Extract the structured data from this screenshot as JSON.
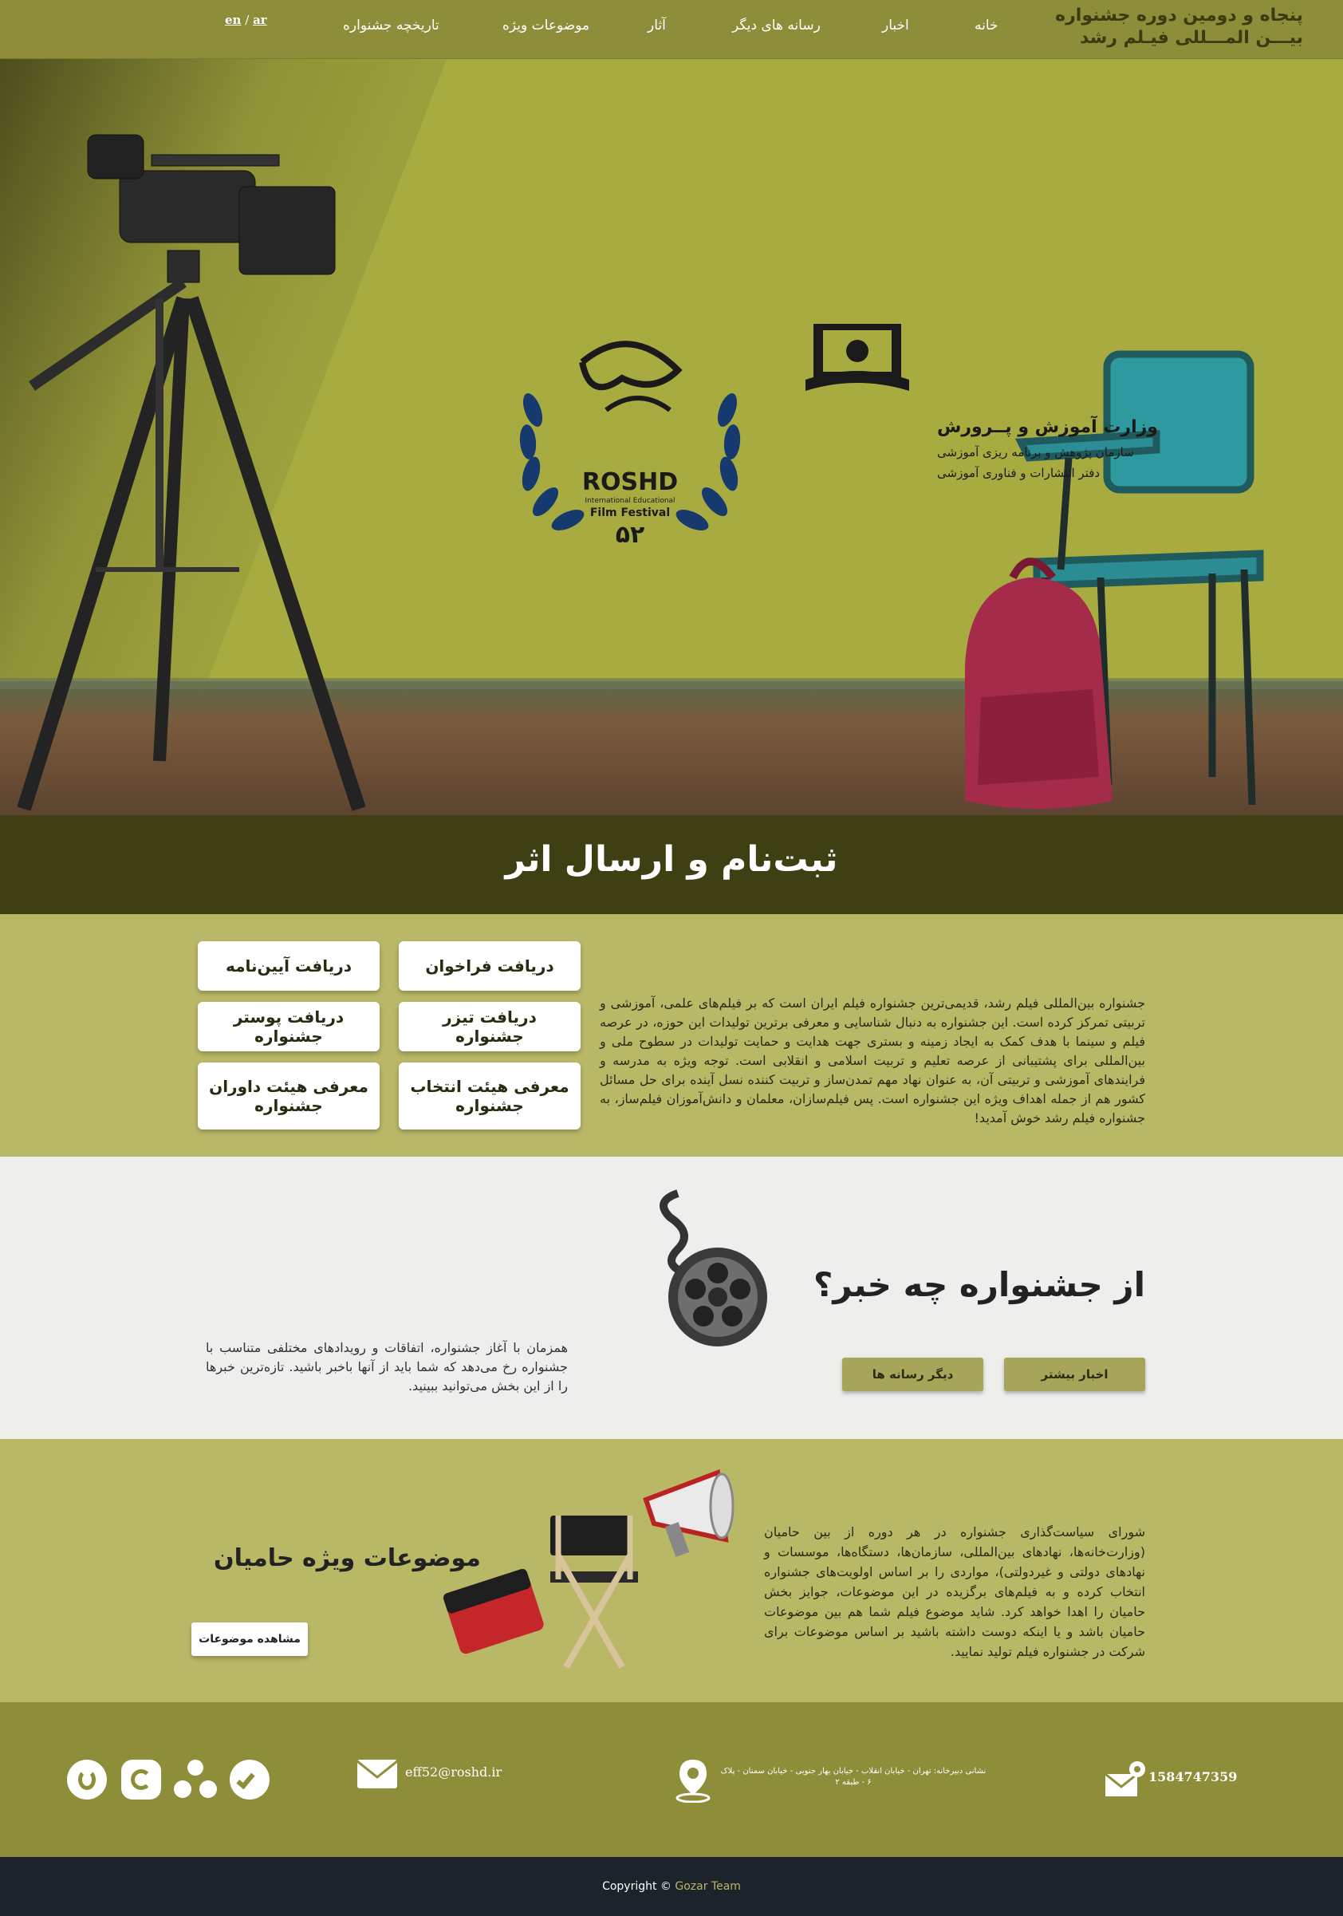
{
  "header": {
    "brand_line1": "پنجاه و دومین دوره جشنواره",
    "brand_line2": "بیـــن المـــللی فیـلم رشد",
    "nav": [
      "خانه",
      "اخبار",
      "رسانه های دیگر",
      "آثار",
      "موضوعات ویژه",
      "تاریخچه جشنواره"
    ],
    "lang_en": "en",
    "lang_sep": "/",
    "lang_ar": "ar"
  },
  "hero": {
    "festival_name": "ROSHD",
    "festival_sub1": "International Educational",
    "festival_sub2": "Film Festival",
    "festival_number": "۵۲",
    "ministry_title": "وزارت آموزش و پــرورش",
    "ministry_line2": "سازمان پژوهش و برنامه ریزی آموزشی",
    "ministry_line3": "دفتر انتشارات و فناوری آموزشی"
  },
  "register": {
    "title": "ثبت‌نام و ارسال اثر",
    "text": "جشنواره بین‌المللی فیلم رشد، قدیمی‌ترین جشنواره فیلم ایران است که بر فیلم‌های علمی، آموزشی و تربیتی تمرکز کرده است. این جشنواره به دنبال شناسایی و معرفی برترین تولیدات این حوزه، در عرصه فیلم و سینما با هدف کمک به ایجاد زمینه و بستری جهت هدایت و حمایت تولیدات در سطوح ملی و بین‌المللی برای پشتیبانی از عرصه تعلیم و تربیت اسلامی و انقلابی است. توجه ویژه به مدرسه و فرایندهای آموزشی و تربیتی آن، به عنوان نهاد مهم تمدن‌ساز و تربیت کننده نسل آینده برای حل مسائل کشور هم از جمله اهداف ویژه این جشنواره است. پس فیلم‌سازان، معلمان و دانش‌آموزان فیلم‌ساز، به جشنواره فیلم رشد خوش آمدید!",
    "buttons": [
      "دریافت فراخوان",
      "دریافت آیین‌نامه",
      "دریافت تیزر جشنواره",
      "دریافت پوستر جشنواره",
      "معرفی هیئت انتخاب جشنواره",
      "معرفی هیئت داوران جشنواره"
    ]
  },
  "news": {
    "title": "از جشنواره چه خبر؟",
    "btn_more": "اخبار بیشتر",
    "btn_media": "دیگر رسانه ها",
    "text": "همزمان با آغاز جشنواره، اتفاقات و رویدادهای مختلفی متناسب با جشنواره رخ می‌دهد که شما باید از آنها باخبر باشید. تازه‌ترین خبرها را از این بخش می‌توانید ببینید."
  },
  "sponsors": {
    "title": "موضوعات ویژه حامیان",
    "button": "مشاهده موضوعات",
    "text": "شورای سیاست‌گذاری جشنواره در هر دوره از بین حامیان (وزارت‌خانه‌ها، نهادهای بین‌المللی، سازمان‌ها، دستگاه‌ها، موسسات و نهادهای دولتی و غیردولتی)، مواردی را بر اساس اولویت‌های جشنواره انتخاب کرده و به فیلم‌های برگزیده در این موضوعات، جوایز بخش حامیان را اهدا خواهد کرد. شاید موضوع فیلم شما هم بین موضوعات حامیان باشد و یا اینکه دوست داشته باشید بر اساس موضوعات برای شرکت در جشنواره فیلم تولید نمایید."
  },
  "footer": {
    "postal": "1584747359",
    "address": "نشانی دبیرخانه: تهران - خیابان انقلاب - خیابان بهار جنوبی - خیابان سمنان - پلاک ۶ - طبقه ۲",
    "email": "eff52@roshd.ir",
    "copyright_prefix": "Copyright ©",
    "copyright_team": "Gozar Team"
  },
  "colors": {
    "olive": "#8e8d39",
    "olive_light": "#b9b867",
    "olive_dark": "#3e3f12",
    "footer_dark": "#1d232b"
  },
  "icons": [
    "mail-pin-icon",
    "location-pin-icon",
    "envelope-icon",
    "social-icon-1",
    "social-icon-2",
    "social-icon-3",
    "social-icon-4",
    "film-reel-icon",
    "camera-icon",
    "chair-icon",
    "backpack-icon",
    "megaphone-icon",
    "briefcase-icon"
  ]
}
